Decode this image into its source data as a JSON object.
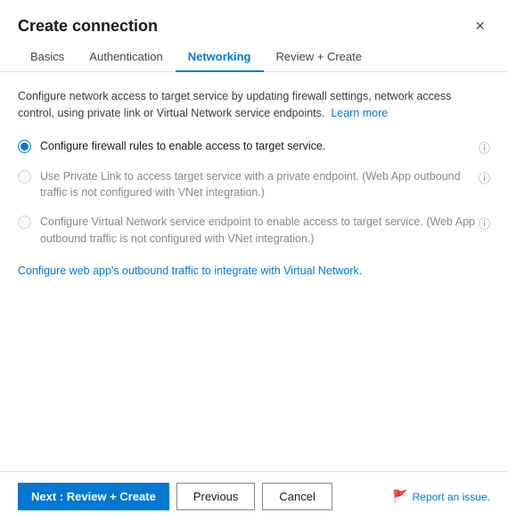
{
  "dialog": {
    "title": "Create connection",
    "close_label": "×"
  },
  "tabs": [
    {
      "id": "basics",
      "label": "Basics",
      "active": false
    },
    {
      "id": "authentication",
      "label": "Authentication",
      "active": false
    },
    {
      "id": "networking",
      "label": "Networking",
      "active": true
    },
    {
      "id": "review-create",
      "label": "Review + Create",
      "active": false
    }
  ],
  "body": {
    "description": "Configure network access to target service by updating firewall settings, network access control, using private link or Virtual Network service endpoints.",
    "learn_more_label": "Learn more",
    "radio_options": [
      {
        "id": "firewall",
        "label": "Configure firewall rules to enable access to target service.",
        "selected": true,
        "disabled": false
      },
      {
        "id": "private-link",
        "label": "Use Private Link to access target service with a private endpoint. (Web App outbound traffic is not configured with VNet integration.)",
        "selected": false,
        "disabled": true
      },
      {
        "id": "vnet-endpoint",
        "label": "Configure Virtual Network service endpoint to enable access to target service. (Web App outbound traffic is not configured with VNet integration.)",
        "selected": false,
        "disabled": true
      }
    ],
    "vnet_link_text": "Configure web app's outbound traffic to integrate with Virtual Network."
  },
  "footer": {
    "next_label": "Next : Review + Create",
    "previous_label": "Previous",
    "cancel_label": "Cancel",
    "report_label": "Report an issue."
  }
}
